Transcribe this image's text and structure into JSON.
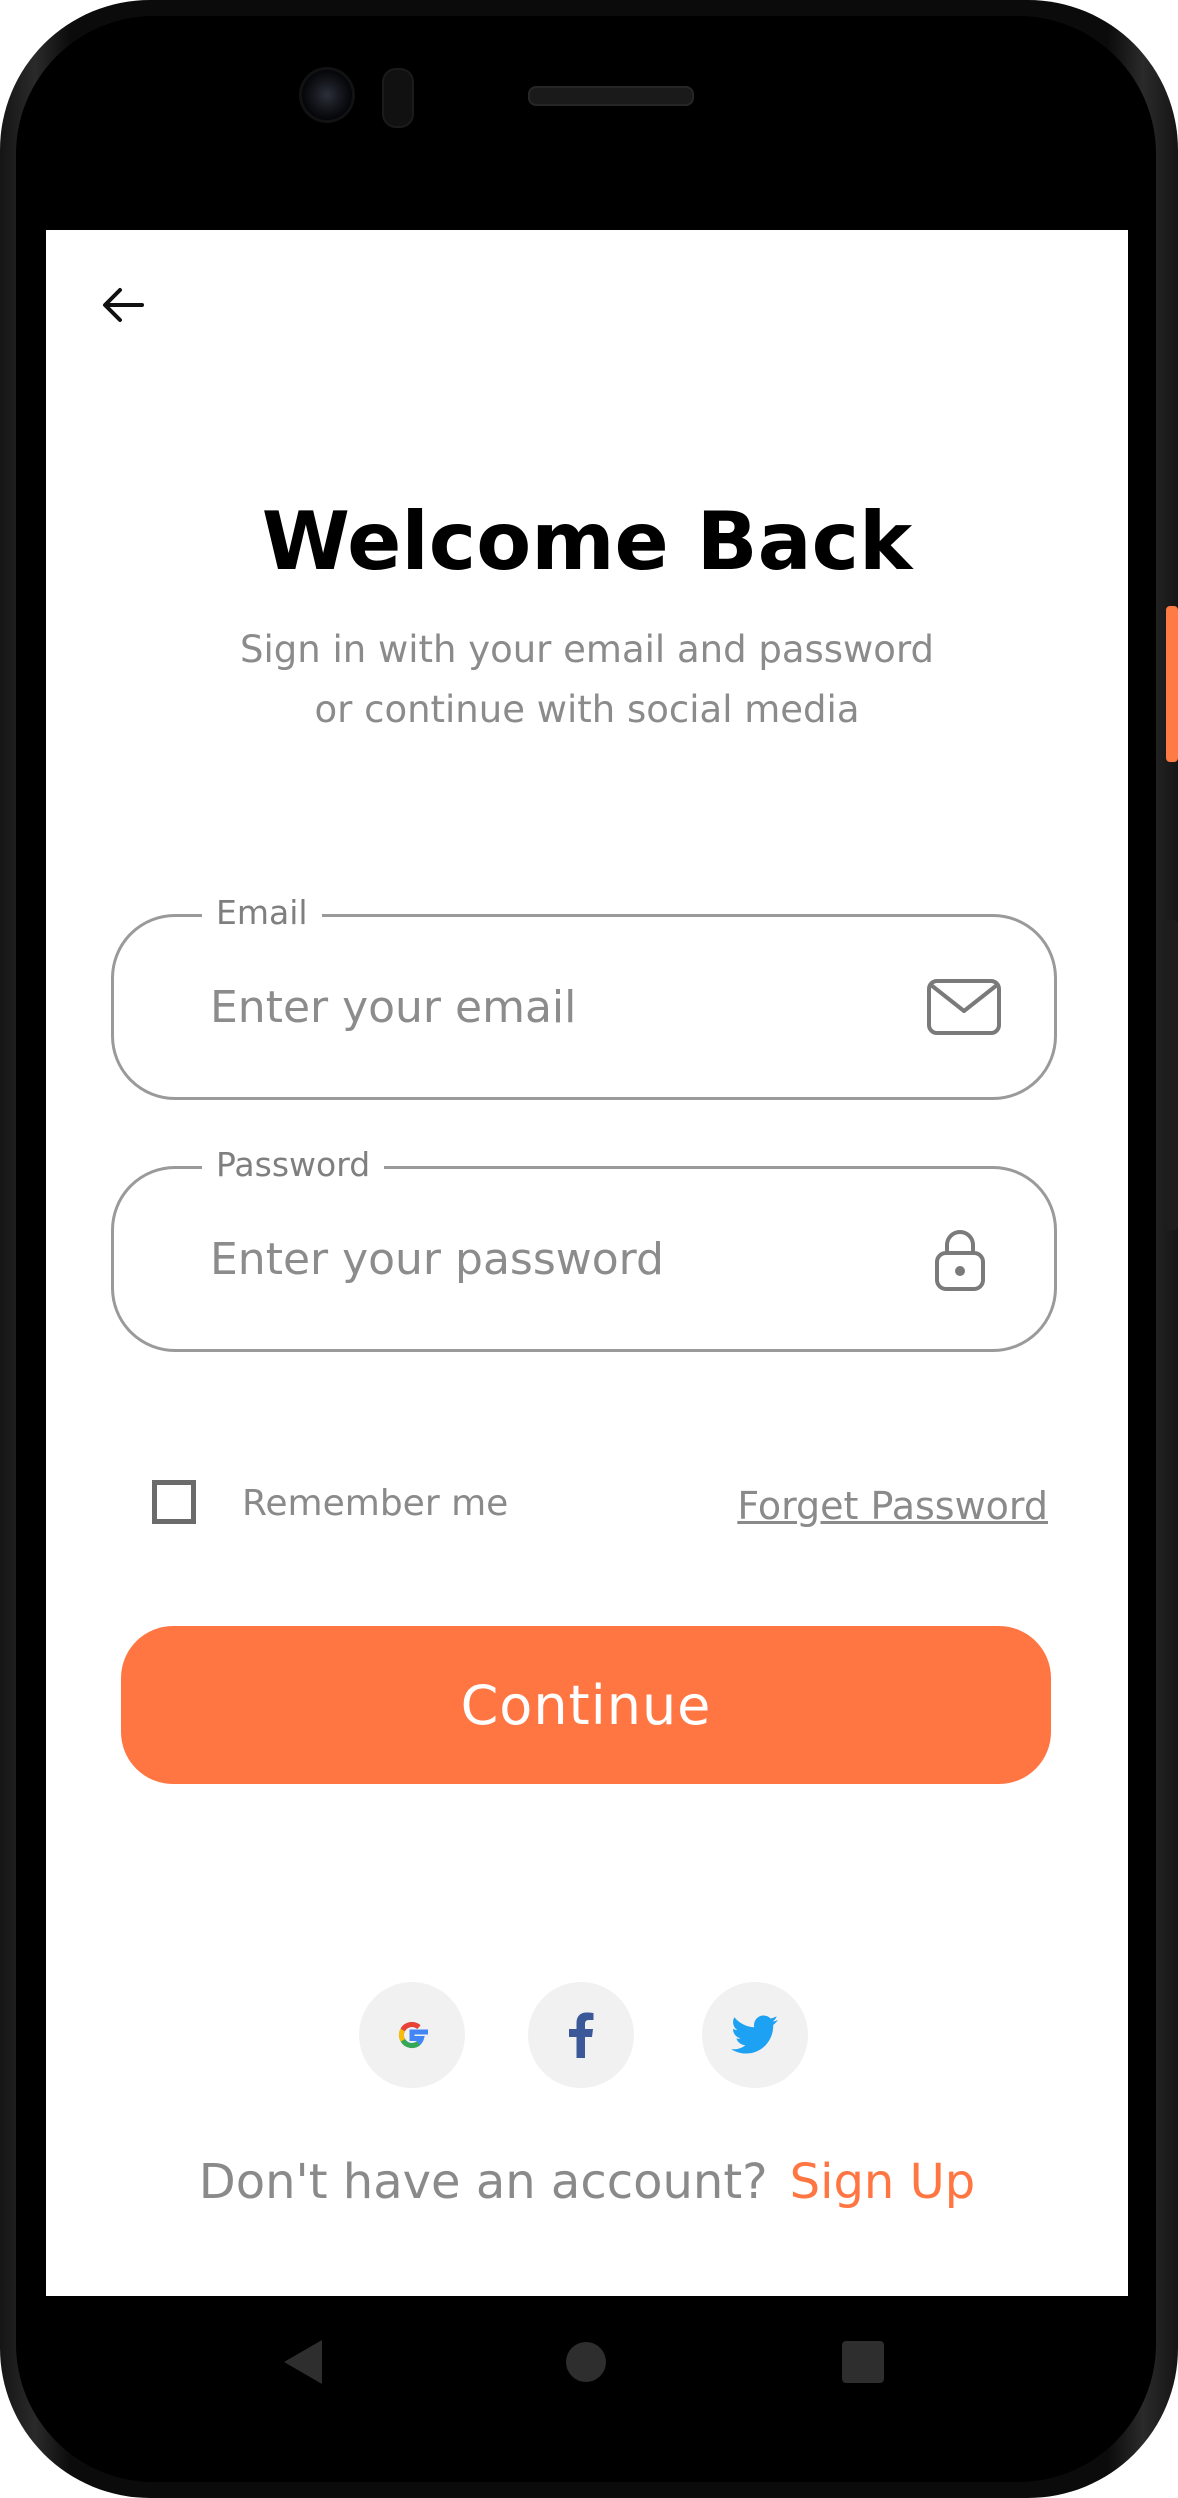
{
  "device": {
    "nav_buttons": [
      "back",
      "home",
      "recent-apps"
    ]
  },
  "header": {
    "back_icon": "arrow-left-icon"
  },
  "welcome": {
    "title": "Welcome Back",
    "subtitle_line1": "Sign in with your email and password",
    "subtitle_line2": "or continue with social media"
  },
  "form": {
    "email": {
      "label": "Email",
      "placeholder": "Enter your email",
      "value": "",
      "icon": "mail-icon"
    },
    "password": {
      "label": "Password",
      "placeholder": "Enter your password",
      "value": "",
      "icon": "lock-icon"
    },
    "remember_label": "Remember me",
    "remember_checked": false,
    "forgot_label": "Forget Password",
    "continue_label": "Continue"
  },
  "social": {
    "providers": [
      "google",
      "facebook",
      "twitter"
    ]
  },
  "footer": {
    "prompt": "Don't have an account?",
    "signup_label": "Sign Up"
  },
  "colors": {
    "accent": "#FF7643",
    "muted_text": "#8A8A8A",
    "title": "#000000",
    "facebook": "#3B5998",
    "twitter": "#1DA1F2"
  }
}
